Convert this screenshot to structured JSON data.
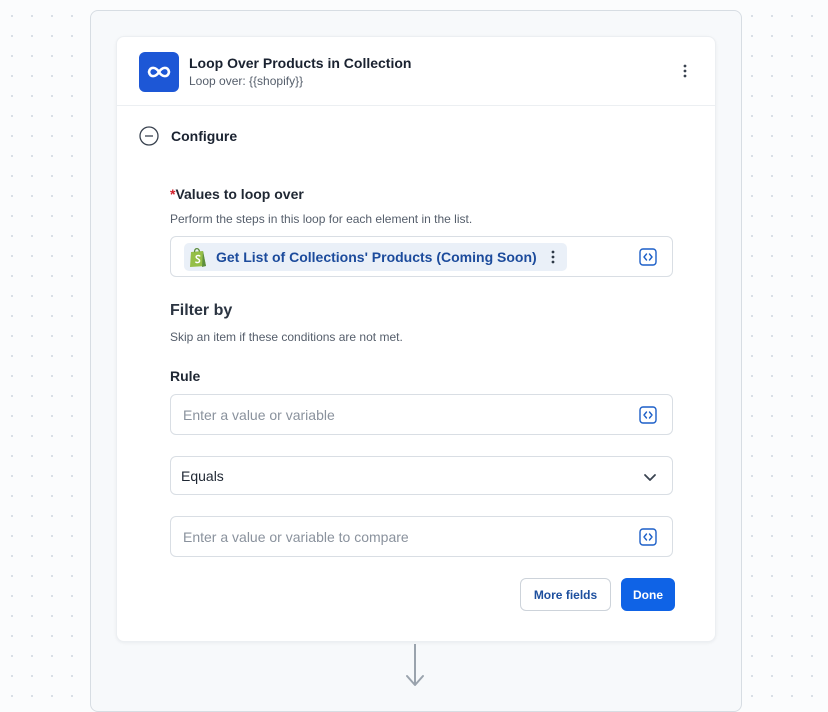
{
  "node": {
    "title": "Loop Over Products in Collection",
    "subtitle": "Loop over: {{shopify}}",
    "icon": "infinity-icon",
    "accent_color": "#1d57d6"
  },
  "section": {
    "label": "Configure",
    "icon": "collapse-minus-icon"
  },
  "values_field": {
    "required_marker": "*",
    "label": "Values to loop over",
    "help": "Perform the steps in this loop for each element in the list.",
    "pill_label": "Get List of Collections' Products (Coming Soon)",
    "pill_icon": "shopify-bag-icon"
  },
  "filter": {
    "heading": "Filter by",
    "help": "Skip an item if these conditions are not met.",
    "rule_label": "Rule",
    "rule_placeholder": "Enter a value or variable",
    "operator_value": "Equals",
    "compare_placeholder": "Enter a value or variable to compare"
  },
  "actions": {
    "more_fields": "More fields",
    "done": "Done"
  },
  "colors": {
    "primary": "#0f63e6",
    "required": "#d11f2b",
    "pill_bg": "#eaf0f8",
    "pill_text": "#1c4b9c"
  }
}
